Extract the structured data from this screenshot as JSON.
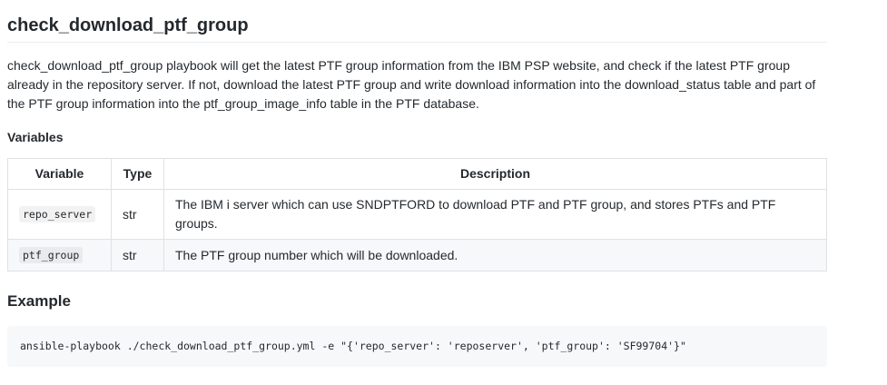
{
  "doc": {
    "title": "check_download_ptf_group",
    "intro": "check_download_ptf_group playbook will get the latest PTF group information from the IBM PSP website, and check if the latest PTF group already in the repository server. If not, download the latest PTF group and write download information into the download_status table and part of the PTF group information into the ptf_group_image_info table in the PTF database.",
    "variables_heading": "Variables",
    "table": {
      "headers": [
        "Variable",
        "Type",
        "Description"
      ],
      "rows": [
        {
          "variable": "repo_server",
          "type": "str",
          "description": "The IBM i server which can use SNDPTFORD to download PTF and PTF group, and stores PTFs and PTF groups."
        },
        {
          "variable": "ptf_group",
          "type": "str",
          "description": "The PTF group number which will be downloaded."
        }
      ]
    },
    "example_heading": "Example",
    "example_code": "ansible-playbook ./check_download_ptf_group.yml -e \"{'repo_server': 'reposerver', 'ptf_group': 'SF99704'}\""
  }
}
